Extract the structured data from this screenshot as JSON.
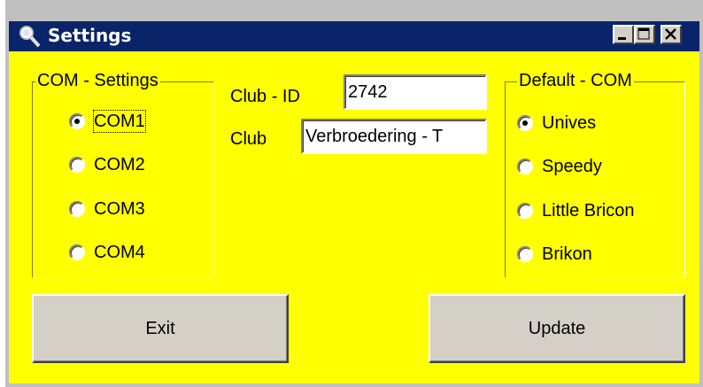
{
  "window": {
    "title": "Settings",
    "icon": "magnifier-icon",
    "colors": {
      "titlebar": "#0a246a",
      "client": "#ffff00",
      "button_face": "#d4d0c8"
    }
  },
  "com_settings": {
    "legend": "COM - Settings",
    "options": [
      {
        "label": "COM1",
        "checked": true
      },
      {
        "label": "COM2",
        "checked": false
      },
      {
        "label": "COM3",
        "checked": false
      },
      {
        "label": "COM4",
        "checked": false
      }
    ]
  },
  "club": {
    "id_label": "Club - ID",
    "id_value": "2742",
    "name_label": "Club",
    "name_value": "Verbroedering - T"
  },
  "default_com": {
    "legend": "Default - COM",
    "options": [
      {
        "label": "Unives",
        "checked": true
      },
      {
        "label": "Speedy",
        "checked": false
      },
      {
        "label": "Little Bricon",
        "checked": false
      },
      {
        "label": "Brikon",
        "checked": false
      }
    ]
  },
  "buttons": {
    "exit": "Exit",
    "update": "Update"
  }
}
